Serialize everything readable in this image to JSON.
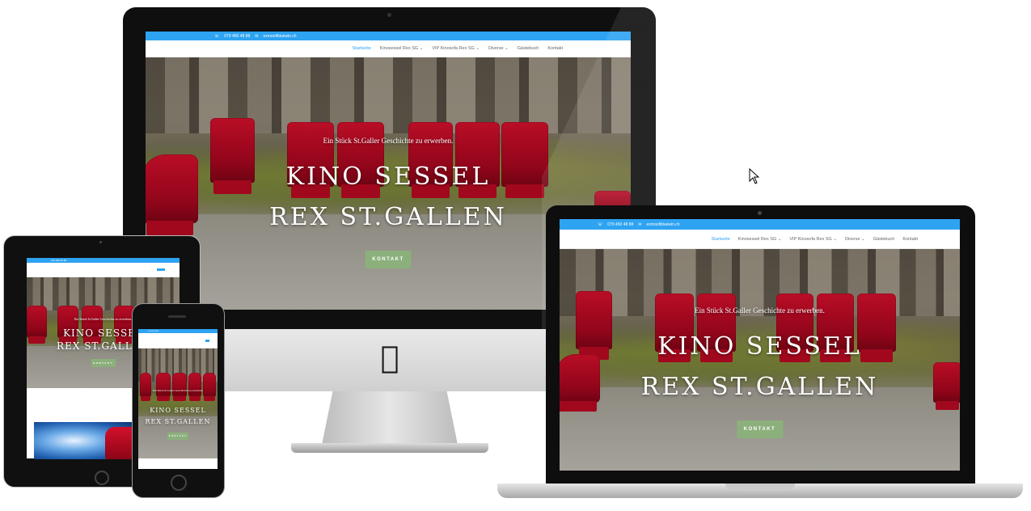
{
  "site": {
    "phone": "079 450 48 88",
    "email": "exmoofibluewin.ch",
    "nav": [
      {
        "label": "Startseite",
        "active": true
      },
      {
        "label": "Kinosessel Rex SG ⌄",
        "active": false
      },
      {
        "label": "VIP Kinosofa Rex SG ⌄",
        "active": false
      },
      {
        "label": "Diverse ⌄",
        "active": false
      },
      {
        "label": "Gästebuch",
        "active": false
      },
      {
        "label": "Kontakt",
        "active": false
      }
    ],
    "hero": {
      "subtitle": "Ein Stück St.Galler Geschichte zu erwerben.",
      "title_line1": "KINO SESSEL",
      "title_line2": "REX ST.GALLEN",
      "button": "KONTAKT"
    }
  },
  "colors": {
    "topbar": "#2ea3f2",
    "active_nav": "#2ea3f2",
    "button": "#8cb07c",
    "seat": "#c10b25"
  },
  "icons": {
    "apple": "apple-logo-icon",
    "cursor": "mouse-pointer-icon",
    "phone": "phone-icon",
    "mail": "mail-icon"
  }
}
